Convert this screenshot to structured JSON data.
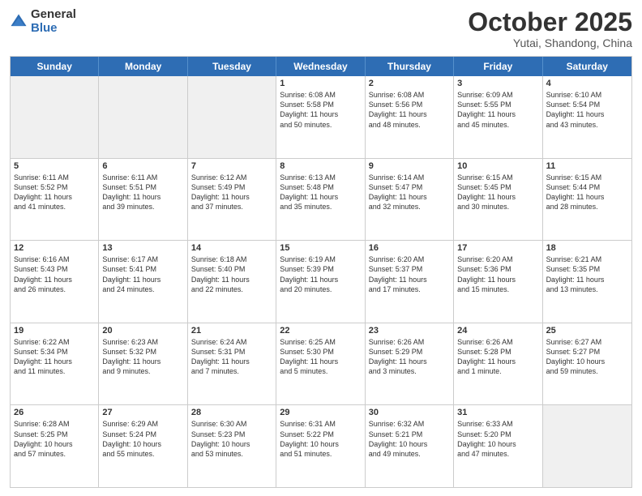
{
  "logo": {
    "general": "General",
    "blue": "Blue"
  },
  "header": {
    "month": "October 2025",
    "location": "Yutai, Shandong, China"
  },
  "weekdays": [
    "Sunday",
    "Monday",
    "Tuesday",
    "Wednesday",
    "Thursday",
    "Friday",
    "Saturday"
  ],
  "weeks": [
    [
      {
        "day": "",
        "lines": [],
        "shaded": true
      },
      {
        "day": "",
        "lines": [],
        "shaded": true
      },
      {
        "day": "",
        "lines": [],
        "shaded": true
      },
      {
        "day": "1",
        "lines": [
          "Sunrise: 6:08 AM",
          "Sunset: 5:58 PM",
          "Daylight: 11 hours",
          "and 50 minutes."
        ]
      },
      {
        "day": "2",
        "lines": [
          "Sunrise: 6:08 AM",
          "Sunset: 5:56 PM",
          "Daylight: 11 hours",
          "and 48 minutes."
        ]
      },
      {
        "day": "3",
        "lines": [
          "Sunrise: 6:09 AM",
          "Sunset: 5:55 PM",
          "Daylight: 11 hours",
          "and 45 minutes."
        ]
      },
      {
        "day": "4",
        "lines": [
          "Sunrise: 6:10 AM",
          "Sunset: 5:54 PM",
          "Daylight: 11 hours",
          "and 43 minutes."
        ]
      }
    ],
    [
      {
        "day": "5",
        "lines": [
          "Sunrise: 6:11 AM",
          "Sunset: 5:52 PM",
          "Daylight: 11 hours",
          "and 41 minutes."
        ]
      },
      {
        "day": "6",
        "lines": [
          "Sunrise: 6:11 AM",
          "Sunset: 5:51 PM",
          "Daylight: 11 hours",
          "and 39 minutes."
        ]
      },
      {
        "day": "7",
        "lines": [
          "Sunrise: 6:12 AM",
          "Sunset: 5:49 PM",
          "Daylight: 11 hours",
          "and 37 minutes."
        ]
      },
      {
        "day": "8",
        "lines": [
          "Sunrise: 6:13 AM",
          "Sunset: 5:48 PM",
          "Daylight: 11 hours",
          "and 35 minutes."
        ]
      },
      {
        "day": "9",
        "lines": [
          "Sunrise: 6:14 AM",
          "Sunset: 5:47 PM",
          "Daylight: 11 hours",
          "and 32 minutes."
        ]
      },
      {
        "day": "10",
        "lines": [
          "Sunrise: 6:15 AM",
          "Sunset: 5:45 PM",
          "Daylight: 11 hours",
          "and 30 minutes."
        ]
      },
      {
        "day": "11",
        "lines": [
          "Sunrise: 6:15 AM",
          "Sunset: 5:44 PM",
          "Daylight: 11 hours",
          "and 28 minutes."
        ]
      }
    ],
    [
      {
        "day": "12",
        "lines": [
          "Sunrise: 6:16 AM",
          "Sunset: 5:43 PM",
          "Daylight: 11 hours",
          "and 26 minutes."
        ]
      },
      {
        "day": "13",
        "lines": [
          "Sunrise: 6:17 AM",
          "Sunset: 5:41 PM",
          "Daylight: 11 hours",
          "and 24 minutes."
        ]
      },
      {
        "day": "14",
        "lines": [
          "Sunrise: 6:18 AM",
          "Sunset: 5:40 PM",
          "Daylight: 11 hours",
          "and 22 minutes."
        ]
      },
      {
        "day": "15",
        "lines": [
          "Sunrise: 6:19 AM",
          "Sunset: 5:39 PM",
          "Daylight: 11 hours",
          "and 20 minutes."
        ]
      },
      {
        "day": "16",
        "lines": [
          "Sunrise: 6:20 AM",
          "Sunset: 5:37 PM",
          "Daylight: 11 hours",
          "and 17 minutes."
        ]
      },
      {
        "day": "17",
        "lines": [
          "Sunrise: 6:20 AM",
          "Sunset: 5:36 PM",
          "Daylight: 11 hours",
          "and 15 minutes."
        ]
      },
      {
        "day": "18",
        "lines": [
          "Sunrise: 6:21 AM",
          "Sunset: 5:35 PM",
          "Daylight: 11 hours",
          "and 13 minutes."
        ]
      }
    ],
    [
      {
        "day": "19",
        "lines": [
          "Sunrise: 6:22 AM",
          "Sunset: 5:34 PM",
          "Daylight: 11 hours",
          "and 11 minutes."
        ]
      },
      {
        "day": "20",
        "lines": [
          "Sunrise: 6:23 AM",
          "Sunset: 5:32 PM",
          "Daylight: 11 hours",
          "and 9 minutes."
        ]
      },
      {
        "day": "21",
        "lines": [
          "Sunrise: 6:24 AM",
          "Sunset: 5:31 PM",
          "Daylight: 11 hours",
          "and 7 minutes."
        ]
      },
      {
        "day": "22",
        "lines": [
          "Sunrise: 6:25 AM",
          "Sunset: 5:30 PM",
          "Daylight: 11 hours",
          "and 5 minutes."
        ]
      },
      {
        "day": "23",
        "lines": [
          "Sunrise: 6:26 AM",
          "Sunset: 5:29 PM",
          "Daylight: 11 hours",
          "and 3 minutes."
        ]
      },
      {
        "day": "24",
        "lines": [
          "Sunrise: 6:26 AM",
          "Sunset: 5:28 PM",
          "Daylight: 11 hours",
          "and 1 minute."
        ]
      },
      {
        "day": "25",
        "lines": [
          "Sunrise: 6:27 AM",
          "Sunset: 5:27 PM",
          "Daylight: 10 hours",
          "and 59 minutes."
        ]
      }
    ],
    [
      {
        "day": "26",
        "lines": [
          "Sunrise: 6:28 AM",
          "Sunset: 5:25 PM",
          "Daylight: 10 hours",
          "and 57 minutes."
        ]
      },
      {
        "day": "27",
        "lines": [
          "Sunrise: 6:29 AM",
          "Sunset: 5:24 PM",
          "Daylight: 10 hours",
          "and 55 minutes."
        ]
      },
      {
        "day": "28",
        "lines": [
          "Sunrise: 6:30 AM",
          "Sunset: 5:23 PM",
          "Daylight: 10 hours",
          "and 53 minutes."
        ]
      },
      {
        "day": "29",
        "lines": [
          "Sunrise: 6:31 AM",
          "Sunset: 5:22 PM",
          "Daylight: 10 hours",
          "and 51 minutes."
        ]
      },
      {
        "day": "30",
        "lines": [
          "Sunrise: 6:32 AM",
          "Sunset: 5:21 PM",
          "Daylight: 10 hours",
          "and 49 minutes."
        ]
      },
      {
        "day": "31",
        "lines": [
          "Sunrise: 6:33 AM",
          "Sunset: 5:20 PM",
          "Daylight: 10 hours",
          "and 47 minutes."
        ]
      },
      {
        "day": "",
        "lines": [],
        "shaded": true
      }
    ]
  ]
}
